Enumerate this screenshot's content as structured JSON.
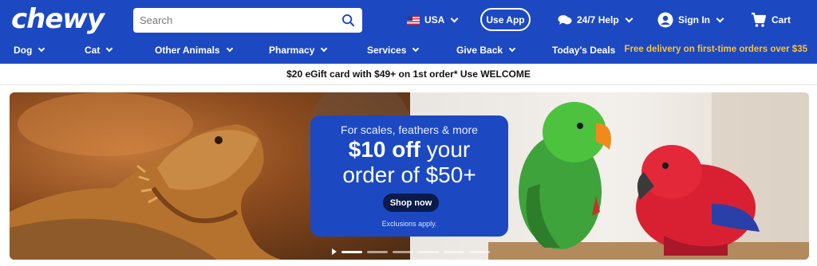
{
  "header": {
    "logo": "chewy",
    "search_placeholder": "Search",
    "country": "USA",
    "use_app": "Use App",
    "help": "24/7 Help",
    "sign_in": "Sign In",
    "cart": "Cart"
  },
  "nav": {
    "items": [
      {
        "label": "Dog",
        "dropdown": true
      },
      {
        "label": "Cat",
        "dropdown": true
      },
      {
        "label": "Other Animals",
        "dropdown": true
      },
      {
        "label": "Pharmacy",
        "dropdown": true
      },
      {
        "label": "Services",
        "dropdown": true
      },
      {
        "label": "Give Back",
        "dropdown": true
      },
      {
        "label": "Today's Deals",
        "dropdown": false
      }
    ],
    "promo": "Free delivery on first-time orders over $35"
  },
  "offer_bar": "$20 eGift card with $49+ on 1st order* Use WELCOME",
  "hero": {
    "subtitle": "For scales, feathers & more",
    "headline_bold": "$10 off",
    "headline_rest": " your",
    "headline_line2": "order of $50+",
    "cta": "Shop now",
    "disclaimer": "Exclusions apply.",
    "carousel": {
      "slides": 6,
      "active": 1
    }
  },
  "colors": {
    "brand_blue": "#1c49c2",
    "promo_yellow": "#ffc12d",
    "cta_dark": "#0a1a4a"
  },
  "icons": [
    "search-icon",
    "us-flag-icon",
    "chat-help-icon",
    "user-icon",
    "cart-icon",
    "chevron-down-icon",
    "play-icon"
  ]
}
